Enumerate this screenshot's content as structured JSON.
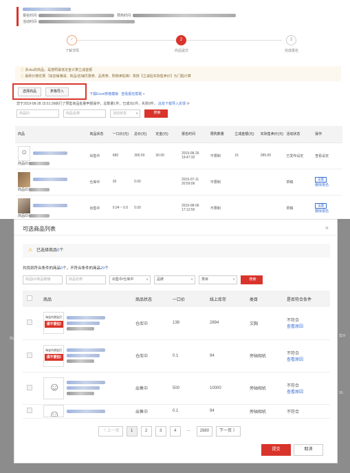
{
  "background": {
    "header": {
      "name_label": "报名时间:",
      "activity_label": "活动时间:",
      "notice_time_label": "预热时间:"
    },
    "steps": [
      {
        "label": "了解详情",
        "mark": "✓"
      },
      {
        "label": "商品提交",
        "mark": "2"
      },
      {
        "label": "完成报名",
        "mark": "3"
      }
    ],
    "notice": {
      "line1": "多sku的商品，是按照最低定金计算立减金额",
      "line2": "最新价格优惠（如店铺满减、商品/店铺优惠券、品类券、购物津贴等）将按【立减后实际售卖价】为门槛计算"
    },
    "tabs": {
      "select_goods": "选择商品",
      "table_import": "表格导入"
    },
    "links": {
      "download_template": "下载Excel表格模板",
      "view_help": "查看报名帮助 »"
    },
    "upload_info": {
      "text": "您于2019-08-28 15:51:39执行了预售商品批量申报操作，总数量1件，已成功1件，失败0件，",
      "link": "此处下载导入反馈"
    },
    "filters": {
      "goods_id": "商品ID",
      "goods_name": "商品名称",
      "status": "活动状态",
      "search": "搜索"
    },
    "table": {
      "headers": [
        "商品",
        "商品状态",
        "一口价(元)",
        "总价(元)",
        "定金(元)",
        "报名时间",
        "限购数量",
        "立减金额(元)",
        "实际售卖价(元)",
        "活动状态",
        "操作"
      ],
      "rows": [
        {
          "id_label": "商品ID:",
          "status": "出售中",
          "price": "680",
          "total": "300.00",
          "deposit": "30.00",
          "time": "2019-08-26",
          "time2": "19:47:32",
          "limit": "不限制",
          "discount": "15",
          "actual": "285.00",
          "act_status": "已发布设定",
          "op": "查看设定"
        },
        {
          "id_label": "商品ID:",
          "status": "仓库中",
          "price": "20",
          "total": "0.00",
          "deposit": "",
          "time": "2019-07-11",
          "time2": "20:59:06",
          "limit": "不限制",
          "discount": "",
          "actual": "",
          "act_status": "草稿",
          "op": "设置",
          "op2": "删除报名"
        },
        {
          "id_label": "商品ID:",
          "status": "出售中",
          "price": "0.04 ~ 0.0",
          "total": "0.00",
          "deposit": "",
          "time": "2019-08-06",
          "time2": "17:12:50",
          "limit": "不限制",
          "discount": "",
          "actual": "",
          "act_status": "草稿",
          "op": "设置",
          "op2": "删除报名"
        }
      ]
    },
    "edge_text": {
      "left1": "商品",
      "right1": "售价",
      "right2": "95."
    }
  },
  "modal": {
    "title": "可选商品列表",
    "close": "×",
    "selected_prefix": "已选择商品",
    "selected_count": "0",
    "selected_suffix": "个",
    "summary": {
      "p1": "共找到符合条件的商品",
      "match": "0",
      "p2": "个，不符合条件的商品",
      "nonmatch": "20",
      "p3": "个"
    },
    "filters": {
      "id_placeholder": "商品ID/商品链接",
      "name_placeholder": "商品名称",
      "status": "出售中/仓库中",
      "brand": "品牌",
      "category": "类目",
      "search": "搜索"
    },
    "table": {
      "headers": [
        "商品",
        "商品状态",
        "一口价",
        "线上库存",
        "类目",
        "是否符合条件"
      ],
      "rows": [
        {
          "img": "banner",
          "img_tag": "淘宝内测宝贝",
          "img_red": "请不要拍!",
          "status": "仓库中",
          "price": "138",
          "stock": "2894",
          "category": "文胸",
          "eligible": "不符合",
          "reason": "查看原因"
        },
        {
          "img": "banner",
          "img_tag": "淘宝内测宝贝",
          "img_red": "请不要拍!",
          "status": "仓库中",
          "price": "0.1",
          "stock": "94",
          "category": "旁轴相机",
          "eligible": "不符合",
          "reason": "查看原因"
        },
        {
          "img": "drawing",
          "img_tag": "",
          "img_red": "",
          "status": "出售中",
          "price": "500",
          "stock": "10000",
          "category": "旁轴相机",
          "eligible": "不符合",
          "reason": "查看原因"
        },
        {
          "img": "drawing",
          "img_tag": "",
          "img_red": "",
          "status": "出售中",
          "price": "0.1",
          "stock": "94",
          "category": "旁轴相机",
          "eligible": "不符合",
          "reason": "查看原因"
        }
      ]
    },
    "pager": {
      "prev": "〈 上一页",
      "pages": [
        "1",
        "2",
        "3",
        "4"
      ],
      "ellipsis": "...",
      "last": "2980",
      "next": "下一页 〉"
    },
    "submit": "提交",
    "cancel": "取消"
  }
}
